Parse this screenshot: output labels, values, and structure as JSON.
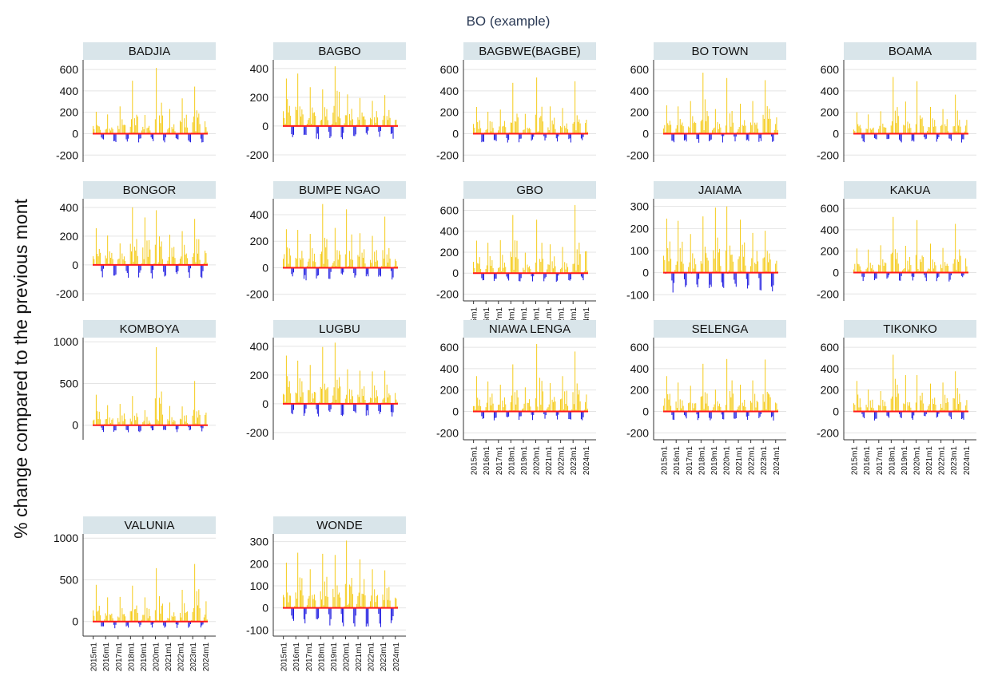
{
  "figure": {
    "title": "BO (example)",
    "ylabel": "% change compared to the previous mont"
  },
  "colors": {
    "positive": "#f5cc1c",
    "negative": "#1a16e0",
    "baseline": "#ff1a1a",
    "strip": "#d9e5ea"
  },
  "chart_data": {
    "type": "bar",
    "layout": "facet-grid 5 columns x 4 rows",
    "x_ticks": [
      "2015m1",
      "2016m1",
      "2017m1",
      "2018m1",
      "2019m1",
      "2020m1",
      "2021m1",
      "2022m1",
      "2023m1",
      "2024m1"
    ],
    "x_range": [
      "2015m1",
      "2024m3"
    ],
    "months": 111,
    "grid": true,
    "legend": "none",
    "panels": [
      {
        "name": "BADJIA",
        "yticks": [
          600,
          400,
          200,
          0,
          -200
        ],
        "ylim": [
          -265,
          690
        ],
        "peaks": [
          [
            3,
            205
          ],
          [
            14,
            180
          ],
          [
            26,
            255
          ],
          [
            38,
            495
          ],
          [
            50,
            175
          ],
          [
            61,
            615
          ],
          [
            74,
            230
          ],
          [
            86,
            330
          ],
          [
            98,
            440
          ]
        ],
        "trough": -85,
        "show_xticks": false
      },
      {
        "name": "BAGBO",
        "yticks": [
          400,
          200,
          0,
          -200
        ],
        "ylim": [
          -250,
          460
        ],
        "peaks": [
          [
            3,
            330
          ],
          [
            14,
            365
          ],
          [
            26,
            270
          ],
          [
            38,
            255
          ],
          [
            50,
            415
          ],
          [
            62,
            220
          ],
          [
            74,
            195
          ],
          [
            86,
            175
          ],
          [
            98,
            215
          ]
        ],
        "trough": -95,
        "show_xticks": false
      },
      {
        "name": "BAGBWE(BAGBE)",
        "yticks": [
          600,
          400,
          200,
          0,
          -200
        ],
        "ylim": [
          -265,
          690
        ],
        "peaks": [
          [
            3,
            250
          ],
          [
            14,
            205
          ],
          [
            26,
            225
          ],
          [
            38,
            475
          ],
          [
            50,
            185
          ],
          [
            61,
            525
          ],
          [
            74,
            255
          ],
          [
            86,
            240
          ],
          [
            98,
            490
          ]
        ],
        "trough": -85,
        "show_xticks": false
      },
      {
        "name": "BO TOWN",
        "yticks": [
          600,
          400,
          200,
          0,
          -200
        ],
        "ylim": [
          -265,
          690
        ],
        "peaks": [
          [
            3,
            265
          ],
          [
            14,
            255
          ],
          [
            26,
            305
          ],
          [
            38,
            570
          ],
          [
            50,
            230
          ],
          [
            61,
            520
          ],
          [
            74,
            280
          ],
          [
            86,
            305
          ],
          [
            98,
            500
          ]
        ],
        "trough": -85,
        "show_xticks": false
      },
      {
        "name": "BOAMA",
        "yticks": [
          600,
          400,
          200,
          0,
          -200
        ],
        "ylim": [
          -265,
          690
        ],
        "peaks": [
          [
            3,
            200
          ],
          [
            14,
            180
          ],
          [
            26,
            210
          ],
          [
            38,
            530
          ],
          [
            50,
            300
          ],
          [
            61,
            490
          ],
          [
            74,
            250
          ],
          [
            86,
            230
          ],
          [
            98,
            365
          ]
        ],
        "trough": -85,
        "show_xticks": false
      },
      {
        "name": "BONGOR",
        "yticks": [
          400,
          200,
          0,
          -200
        ],
        "ylim": [
          -250,
          460
        ],
        "peaks": [
          [
            3,
            255
          ],
          [
            14,
            205
          ],
          [
            26,
            150
          ],
          [
            38,
            400
          ],
          [
            50,
            330
          ],
          [
            61,
            380
          ],
          [
            74,
            210
          ],
          [
            86,
            235
          ],
          [
            98,
            320
          ]
        ],
        "trough": -95,
        "show_xticks": false
      },
      {
        "name": "BUMPE NGAO",
        "yticks": [
          400,
          200,
          0,
          -200
        ],
        "ylim": [
          -250,
          520
        ],
        "peaks": [
          [
            3,
            290
          ],
          [
            14,
            285
          ],
          [
            26,
            255
          ],
          [
            38,
            480
          ],
          [
            50,
            300
          ],
          [
            61,
            440
          ],
          [
            74,
            260
          ],
          [
            86,
            240
          ],
          [
            98,
            385
          ]
        ],
        "trough": -95,
        "show_xticks": false
      },
      {
        "name": "GBO",
        "yticks": [
          600,
          400,
          200,
          0,
          -200
        ],
        "ylim": [
          -265,
          710
        ],
        "peaks": [
          [
            3,
            310
          ],
          [
            14,
            290
          ],
          [
            26,
            315
          ],
          [
            38,
            555
          ],
          [
            50,
            195
          ],
          [
            61,
            510
          ],
          [
            74,
            275
          ],
          [
            86,
            250
          ],
          [
            98,
            650
          ]
        ],
        "trough": -85,
        "show_xticks": true
      },
      {
        "name": "JAIAMA",
        "yticks": [
          300,
          200,
          100,
          0,
          -100
        ],
        "ylim": [
          -128,
          335
        ],
        "peaks": [
          [
            3,
            245
          ],
          [
            14,
            235
          ],
          [
            26,
            175
          ],
          [
            38,
            255
          ],
          [
            50,
            295
          ],
          [
            61,
            300
          ],
          [
            74,
            240
          ],
          [
            86,
            180
          ],
          [
            98,
            190
          ]
        ],
        "trough": -90,
        "show_xticks": false
      },
      {
        "name": "KAKUA",
        "yticks": [
          600,
          400,
          200,
          0,
          -200
        ],
        "ylim": [
          -265,
          690
        ],
        "peaks": [
          [
            3,
            225
          ],
          [
            14,
            215
          ],
          [
            26,
            255
          ],
          [
            38,
            520
          ],
          [
            50,
            250
          ],
          [
            61,
            490
          ],
          [
            74,
            270
          ],
          [
            86,
            230
          ],
          [
            98,
            455
          ]
        ],
        "trough": -85,
        "show_xticks": false
      },
      {
        "name": "KOMBOYA",
        "yticks": [
          1000,
          500,
          0
        ],
        "ylim": [
          -175,
          1050
        ],
        "peaks": [
          [
            3,
            365
          ],
          [
            14,
            240
          ],
          [
            26,
            255
          ],
          [
            38,
            350
          ],
          [
            50,
            180
          ],
          [
            61,
            935
          ],
          [
            74,
            230
          ],
          [
            86,
            225
          ],
          [
            98,
            530
          ]
        ],
        "trough": -85,
        "show_xticks": false
      },
      {
        "name": "LUGBU",
        "yticks": [
          400,
          200,
          0,
          -200
        ],
        "ylim": [
          -250,
          460
        ],
        "peaks": [
          [
            3,
            335
          ],
          [
            14,
            300
          ],
          [
            26,
            270
          ],
          [
            38,
            395
          ],
          [
            50,
            425
          ],
          [
            62,
            240
          ],
          [
            74,
            230
          ],
          [
            86,
            225
          ],
          [
            98,
            230
          ]
        ],
        "trough": -90,
        "show_xticks": false
      },
      {
        "name": "NIAWA LENGA",
        "yticks": [
          600,
          400,
          200,
          0,
          -200
        ],
        "ylim": [
          -265,
          690
        ],
        "peaks": [
          [
            3,
            330
          ],
          [
            14,
            280
          ],
          [
            26,
            250
          ],
          [
            38,
            440
          ],
          [
            50,
            225
          ],
          [
            61,
            630
          ],
          [
            74,
            265
          ],
          [
            86,
            330
          ],
          [
            98,
            560
          ]
        ],
        "trough": -85,
        "show_xticks": true
      },
      {
        "name": "SELENGA",
        "yticks": [
          600,
          400,
          200,
          0,
          -200
        ],
        "ylim": [
          -265,
          690
        ],
        "peaks": [
          [
            3,
            330
          ],
          [
            14,
            270
          ],
          [
            26,
            240
          ],
          [
            38,
            445
          ],
          [
            50,
            205
          ],
          [
            61,
            490
          ],
          [
            74,
            250
          ],
          [
            86,
            290
          ],
          [
            98,
            485
          ]
        ],
        "trough": -85,
        "show_xticks": true
      },
      {
        "name": "TIKONKO",
        "yticks": [
          600,
          400,
          200,
          0,
          -200
        ],
        "ylim": [
          -265,
          690
        ],
        "peaks": [
          [
            3,
            285
          ],
          [
            14,
            205
          ],
          [
            26,
            190
          ],
          [
            38,
            530
          ],
          [
            50,
            340
          ],
          [
            61,
            340
          ],
          [
            74,
            260
          ],
          [
            86,
            270
          ],
          [
            98,
            375
          ]
        ],
        "trough": -85,
        "show_xticks": true
      },
      {
        "name": "VALUNIA",
        "yticks": [
          1000,
          500,
          0
        ],
        "ylim": [
          -175,
          1050
        ],
        "peaks": [
          [
            3,
            440
          ],
          [
            14,
            290
          ],
          [
            26,
            295
          ],
          [
            38,
            430
          ],
          [
            50,
            290
          ],
          [
            61,
            640
          ],
          [
            74,
            230
          ],
          [
            86,
            380
          ],
          [
            98,
            690
          ]
        ],
        "trough": -85,
        "show_xticks": true
      },
      {
        "name": "WONDE",
        "yticks": [
          300,
          200,
          100,
          0,
          -100
        ],
        "ylim": [
          -128,
          335
        ],
        "peaks": [
          [
            3,
            205
          ],
          [
            14,
            250
          ],
          [
            26,
            175
          ],
          [
            38,
            245
          ],
          [
            50,
            240
          ],
          [
            61,
            305
          ],
          [
            74,
            220
          ],
          [
            86,
            175
          ],
          [
            98,
            170
          ]
        ],
        "trough": -90,
        "show_xticks": true
      }
    ]
  }
}
